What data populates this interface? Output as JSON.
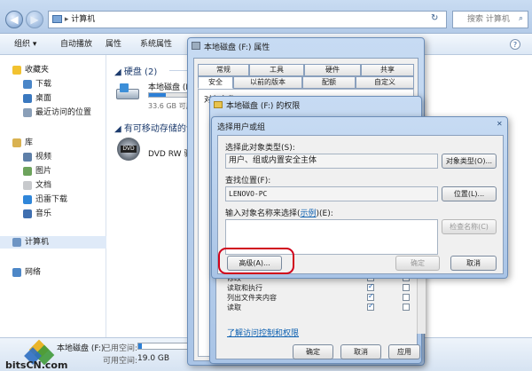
{
  "explorer": {
    "address": "计算机",
    "search_placeholder": "搜索 计算机",
    "toolbar": [
      "组织 ▾",
      "自动播放",
      "属性",
      "系统属性"
    ],
    "favorites": {
      "header": "收藏夹",
      "items": [
        "下载",
        "桌面",
        "最近访问的位置"
      ]
    },
    "libraries": {
      "header": "库",
      "items": [
        "视频",
        "图片",
        "文档",
        "迅雷下载",
        "音乐"
      ]
    },
    "computer_label": "计算机",
    "network_label": "网络",
    "hdd_group": "硬盘 (2)",
    "drive_name": "本地磁盘 (F",
    "drive_size": "33.6 GB 可用",
    "removable_group": "有可移动存储的设",
    "dvd_name": "DVD RW 驱",
    "status": {
      "name": "本地磁盘 (F:)",
      "used_label": "已用空间:",
      "free_label": "可用空间:",
      "free_value": "19.0 GB",
      "used_fraction": 0.05
    },
    "watermark": "bitsCN.com"
  },
  "properties": {
    "title": "本地磁盘 (F:) 属性",
    "tabs_row1": [
      "常规",
      "工具",
      "硬件",
      "共享"
    ],
    "tabs_row2": [
      "安全",
      "以前的版本",
      "配额",
      "自定义"
    ],
    "object_label": "对象名称:"
  },
  "permissions": {
    "title": "本地磁盘 (F:) 的权限",
    "rows": [
      {
        "name": "修改",
        "allow": true,
        "deny": false
      },
      {
        "name": "读取和执行",
        "allow": true,
        "deny": false
      },
      {
        "name": "列出文件夹内容",
        "allow": true,
        "deny": false
      },
      {
        "name": "读取",
        "allow": true,
        "deny": false
      }
    ],
    "help_link": "了解访问控制和权限",
    "ok": "确定",
    "cancel": "取消",
    "apply": "应用"
  },
  "select": {
    "title": "选择用户或组",
    "type_label": "选择此对象类型(S):",
    "type_value": "用户、组或内置安全主体",
    "type_btn": "对象类型(O)...",
    "location_label": "查找位置(F):",
    "location_value": "LENOVO-PC",
    "location_btn": "位置(L)...",
    "names_label_a": "输入对象名称来选择(",
    "names_label_link": "示例",
    "names_label_b": ")(E):",
    "check_btn": "检查名称(C)",
    "advanced_btn": "高级(A)...",
    "ok": "确定",
    "cancel": "取消"
  },
  "colors": {
    "highlight": "#d0021b",
    "link": "#0b5fb0",
    "drive_bar": "#2c7fd6"
  }
}
